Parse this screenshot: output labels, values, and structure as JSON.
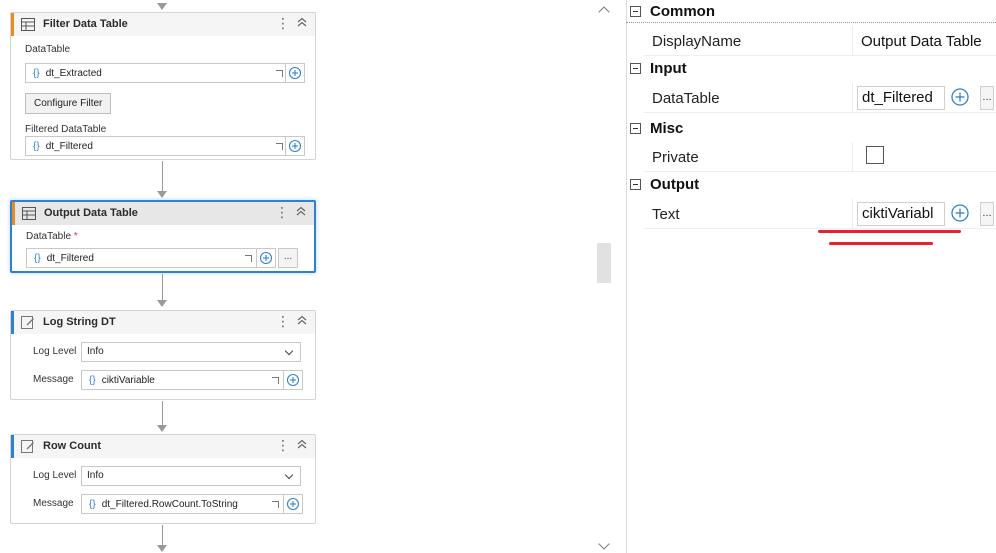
{
  "colors": {
    "accent_orange": "#e88b24",
    "accent_blue": "#2f80d1",
    "selection_border": "#2f80d1",
    "annotation_red": "#e3242b"
  },
  "workflow": {
    "filter_data_table": {
      "title": "Filter Data Table",
      "icon": "data-table-icon",
      "datatable_label": "DataTable",
      "datatable_value": "dt_Extracted",
      "configure_button": "Configure Filter",
      "filtered_label": "Filtered DataTable",
      "filtered_value": "dt_Filtered"
    },
    "output_data_table": {
      "title": "Output Data Table",
      "icon": "data-table-icon",
      "datatable_label": "DataTable",
      "required_mark": "*",
      "datatable_value": "dt_Filtered",
      "more_label": "..."
    },
    "log_string_dt": {
      "title": "Log String DT",
      "icon": "log-message-icon",
      "log_level_label": "Log Level",
      "log_level_value": "Info",
      "message_label": "Message",
      "message_value": "ciktiVariable"
    },
    "row_count": {
      "title": "Row Count",
      "icon": "log-message-icon",
      "log_level_label": "Log Level",
      "log_level_value": "Info",
      "message_label": "Message",
      "message_value": "dt_Filtered.RowCount.ToString"
    },
    "brace_glyph": "{}",
    "kebab_glyph": "⋮",
    "collapse_glyph": "⌃"
  },
  "properties": {
    "categories": {
      "common": "Common",
      "input": "Input",
      "misc": "Misc",
      "output": "Output"
    },
    "display_name_label": "DisplayName",
    "display_name_value": "Output Data Table",
    "datatable_label": "DataTable",
    "datatable_value": "dt_Filtered",
    "private_label": "Private",
    "private_checked": false,
    "text_label": "Text",
    "text_value": "ciktiVariabl",
    "more_label": "..."
  }
}
